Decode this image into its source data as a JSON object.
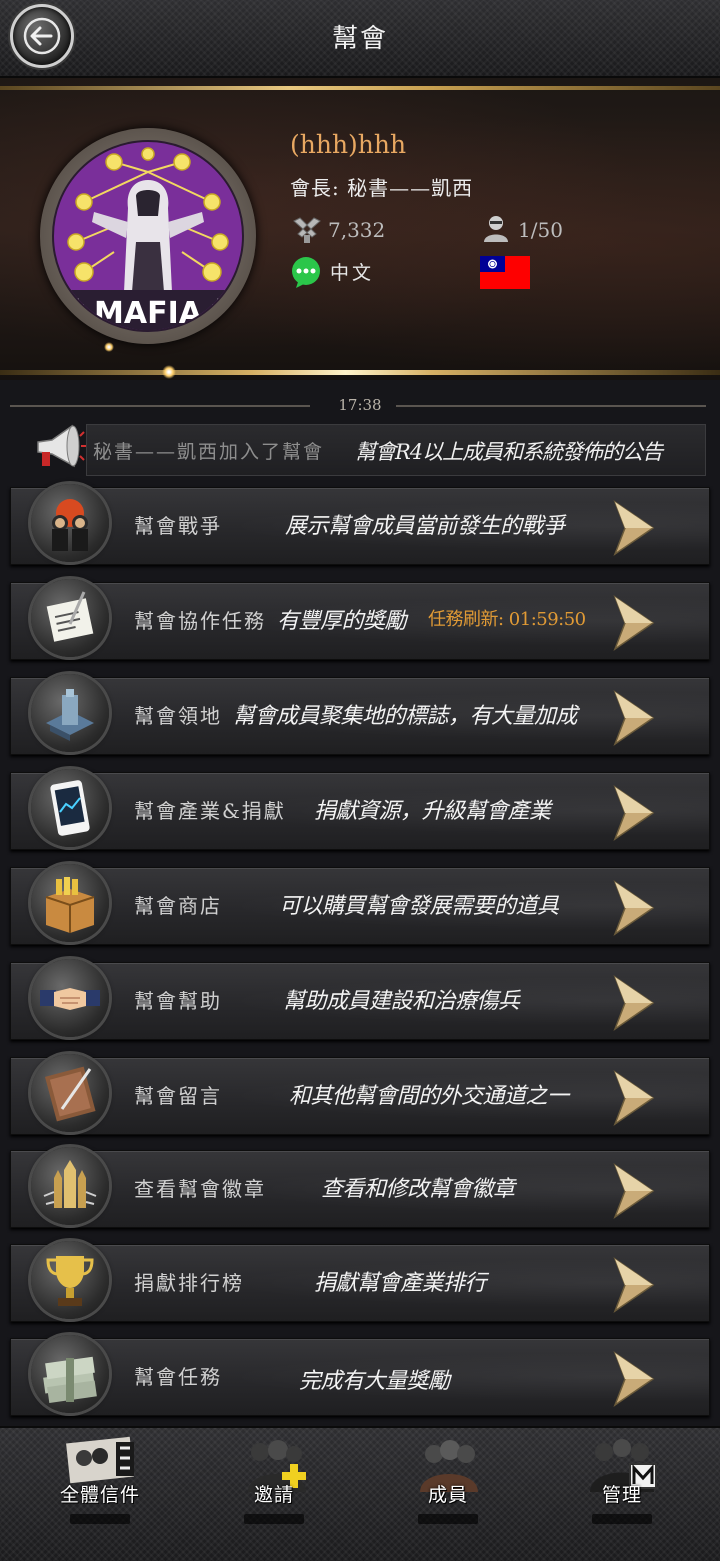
{
  "header": {
    "title": "幫會",
    "back_icon": "back-arrow-icon"
  },
  "guild": {
    "name": "(hhh)hhh",
    "leader": "會長: 秘書——凱西",
    "power": "7,332",
    "members": "1/50",
    "language": "中文",
    "emblem_text": "MAFIA",
    "flag": "taiwan-flag-icon"
  },
  "notice": {
    "time": "17:38",
    "message": "秘書——凱西加入了幫會",
    "info": "幫會R4以上成員和系統發佈的公告"
  },
  "menu": [
    {
      "title": "幫會戰爭",
      "desc": "展示幫會成員當前發生的戰爭",
      "icon": "gangsters-icon"
    },
    {
      "title": "幫會協作任務",
      "desc": "有豐厚的獎勵",
      "extra": "任務刷新:  01:59:50",
      "icon": "clipboard-icon"
    },
    {
      "title": "幫會領地",
      "desc": "幫會成員聚集地的標誌，有大量加成",
      "icon": "building-icon"
    },
    {
      "title": "幫會產業&捐獻",
      "desc": "捐獻資源，升級幫會產業",
      "icon": "tablet-icon"
    },
    {
      "title": "幫會商店",
      "desc": "可以購買幫會發展需要的道具",
      "icon": "crate-icon"
    },
    {
      "title": "幫會幫助",
      "desc": "幫助成員建設和治療傷兵",
      "icon": "handshake-icon"
    },
    {
      "title": "幫會留言",
      "desc": "和其他幫會間的外交通道之一",
      "icon": "notebook-icon"
    },
    {
      "title": "查看幫會徽章",
      "desc": "查看和修改幫會徽章",
      "icon": "bullets-icon"
    },
    {
      "title": "捐獻排行榜",
      "desc": "捐獻幫會產業排行",
      "icon": "trophy-icon"
    },
    {
      "title": "幫會任務",
      "desc": "完成有大量獎勵",
      "icon": "money-icon"
    }
  ],
  "nav": [
    {
      "label": "全體信件",
      "icon": "mail-all-icon"
    },
    {
      "label": "邀請",
      "icon": "invite-icon"
    },
    {
      "label": "成員",
      "icon": "members-icon"
    },
    {
      "label": "管理",
      "icon": "manage-icon"
    }
  ],
  "colors": {
    "accent_gold": "#d6b064",
    "guild_name": "#e8a862",
    "timer": "#e09a35",
    "emblem_bg": "#7a2f9a"
  }
}
